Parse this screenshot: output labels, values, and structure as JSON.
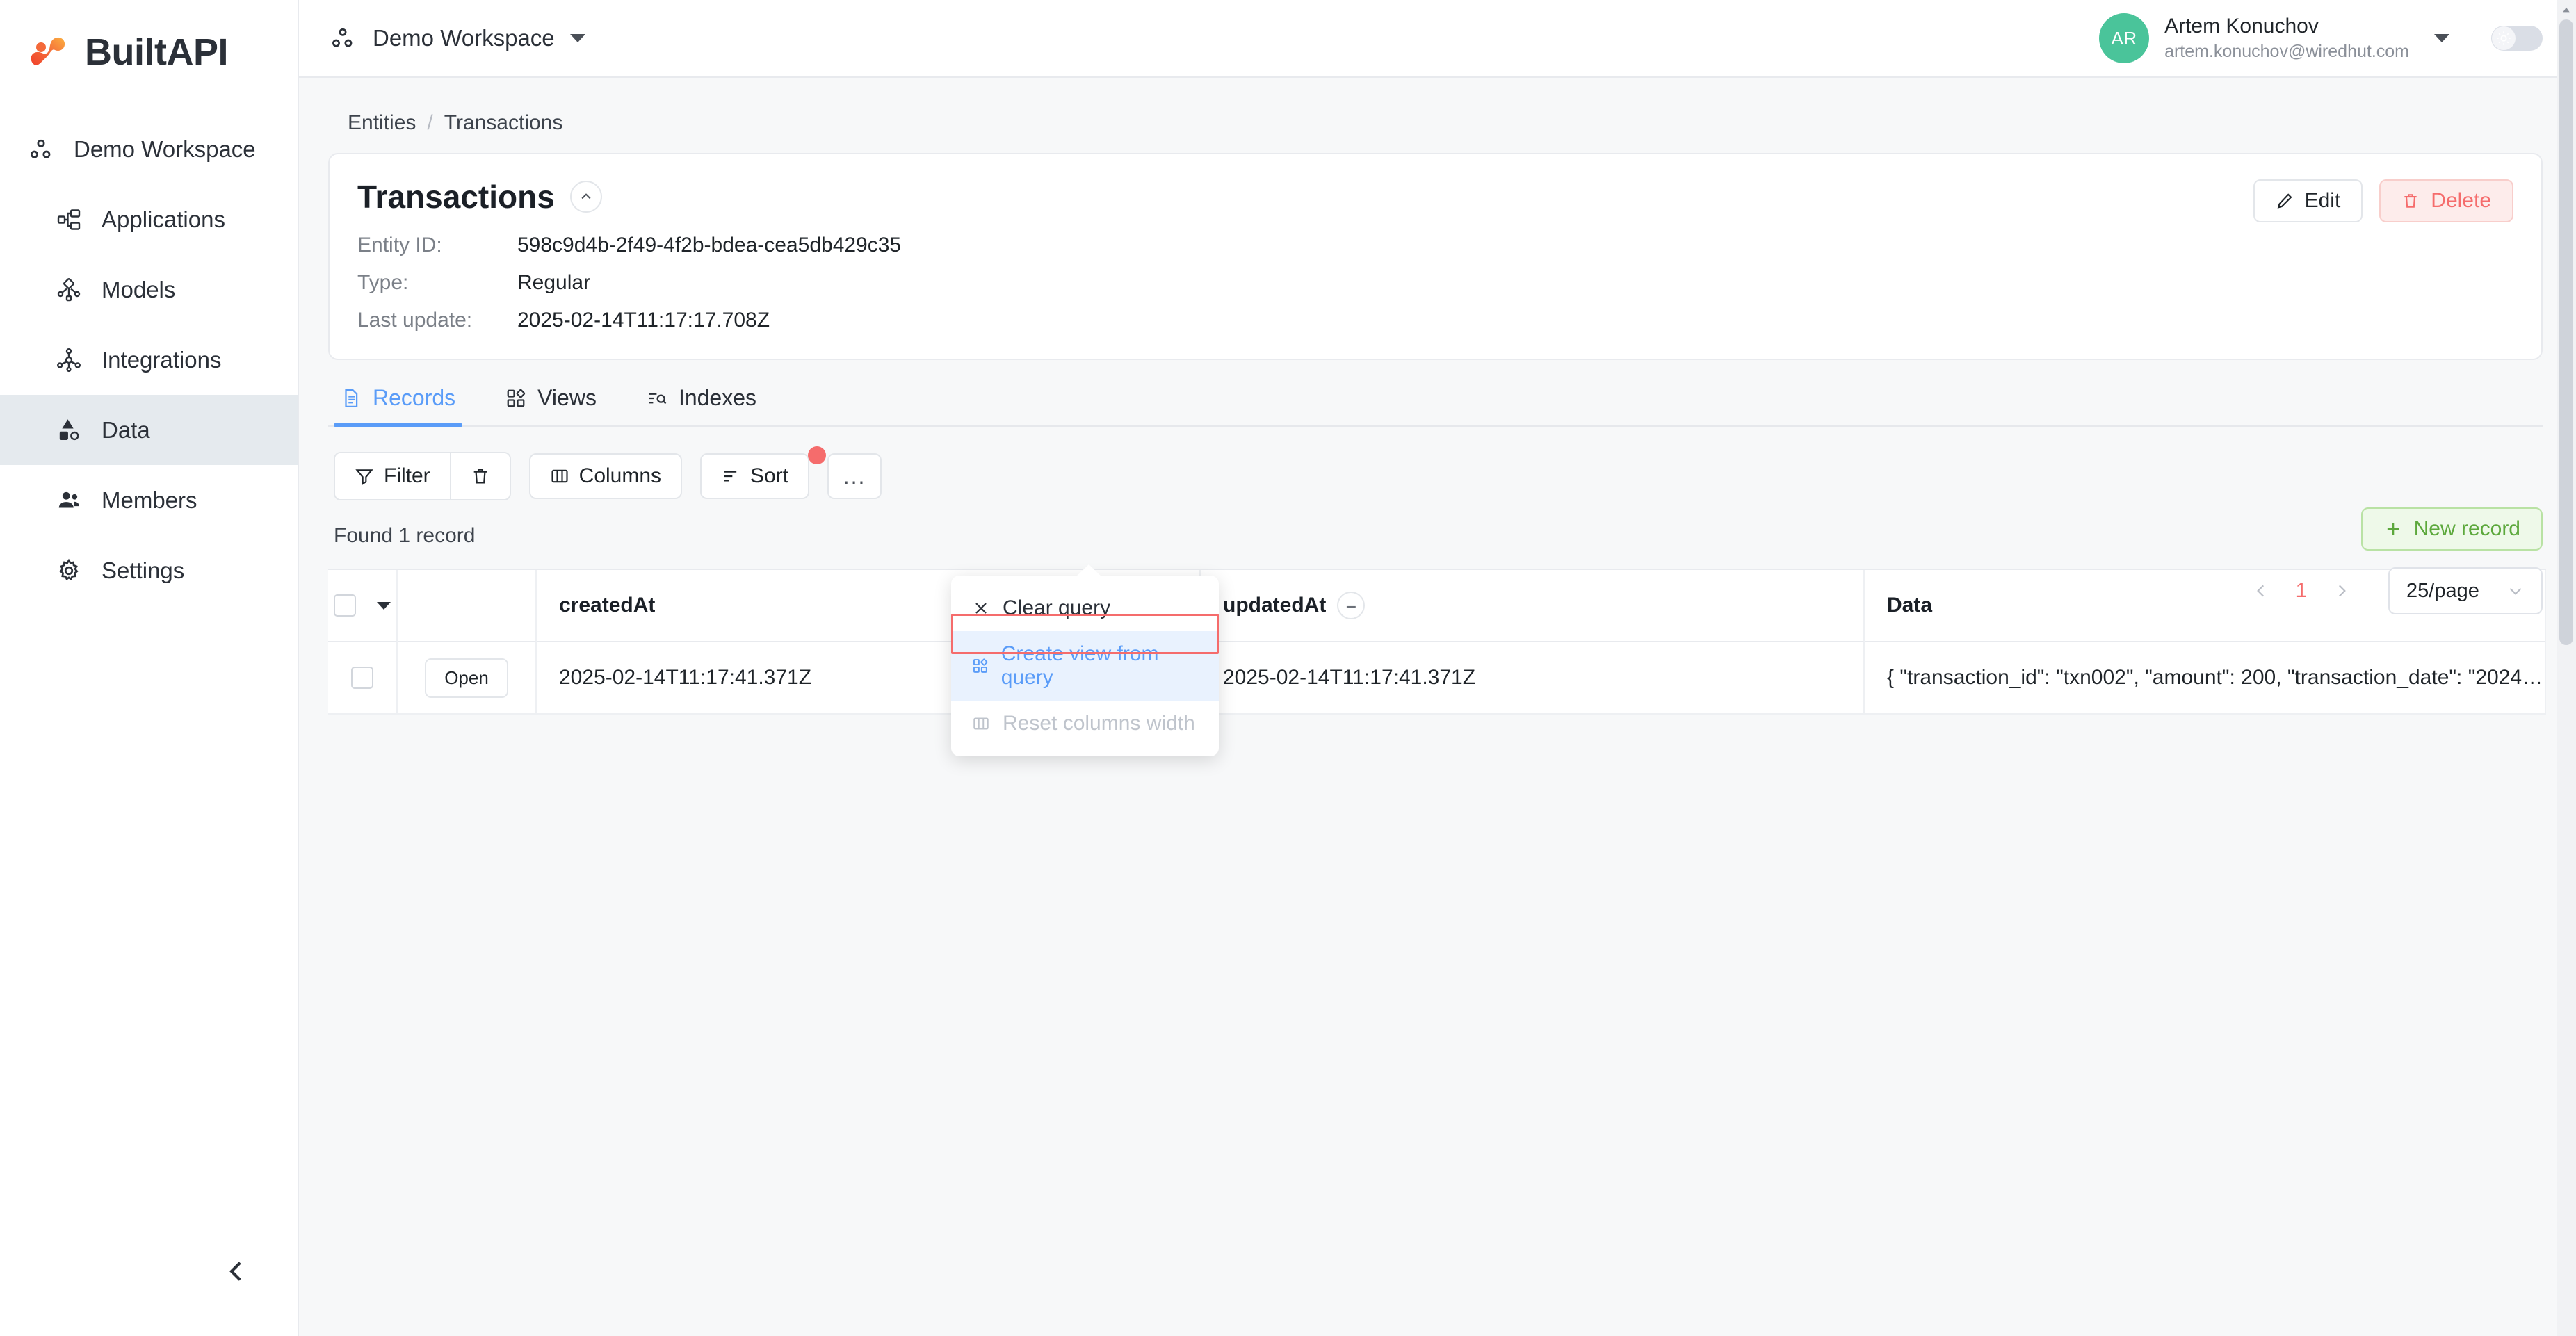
{
  "brand": {
    "name": "BuiltAPI",
    "logo_icon": "builtapi-logo-icon"
  },
  "sidebar": {
    "workspace_label": "Demo Workspace",
    "items": [
      {
        "label": "Applications",
        "icon": "applications-icon"
      },
      {
        "label": "Models",
        "icon": "models-icon"
      },
      {
        "label": "Integrations",
        "icon": "integrations-icon"
      },
      {
        "label": "Data",
        "icon": "data-icon"
      },
      {
        "label": "Members",
        "icon": "members-icon"
      },
      {
        "label": "Settings",
        "icon": "settings-gear-icon"
      }
    ],
    "active_item": "Data",
    "collapse_icon": "chevron-left-icon"
  },
  "topbar": {
    "workspace": "Demo Workspace",
    "workspace_icon": "workspace-dots-icon",
    "user": {
      "initials": "AR",
      "name": "Artem Konuchov",
      "email": "artem.konuchov@wiredhut.com"
    },
    "theme_toggle_icon": "sun-icon"
  },
  "breadcrumb": {
    "root": "Entities",
    "separator": "/",
    "current": "Transactions"
  },
  "entity": {
    "title": "Transactions",
    "collapse_icon": "chevron-up-icon",
    "fields": [
      {
        "key": "Entity ID:",
        "value": "598c9d4b-2f49-4f2b-bdea-cea5db429c35"
      },
      {
        "key": "Type:",
        "value": "Regular"
      },
      {
        "key": "Last update:",
        "value": "2025-02-14T11:17:17.708Z"
      }
    ],
    "edit_label": "Edit",
    "edit_icon": "pencil-icon",
    "delete_label": "Delete",
    "delete_icon": "trash-icon"
  },
  "tabs": [
    {
      "label": "Records",
      "icon": "document-icon",
      "active": true
    },
    {
      "label": "Views",
      "icon": "views-grid-icon",
      "active": false
    },
    {
      "label": "Indexes",
      "icon": "indexes-icon",
      "active": false
    }
  ],
  "toolbar": {
    "filter_label": "Filter",
    "filter_icon": "funnel-icon",
    "filter_clear_icon": "trash-icon",
    "columns_label": "Columns",
    "columns_icon": "columns-icon",
    "sort_label": "Sort",
    "sort_icon": "sort-icon",
    "more_label": "...",
    "new_record_label": "New record",
    "new_record_icon": "plus-icon",
    "has_filter_badge": true
  },
  "dropdown": {
    "items": [
      {
        "label": "Clear query",
        "icon": "close-x-icon",
        "state": "normal"
      },
      {
        "label": "Create view from query",
        "icon": "views-grid-icon",
        "state": "highlighted"
      },
      {
        "label": "Reset columns width",
        "icon": "columns-icon",
        "state": "disabled"
      }
    ]
  },
  "results": {
    "found_text": "Found 1 record"
  },
  "pagination": {
    "prev_icon": "chevron-left-icon",
    "next_icon": "chevron-right-icon",
    "current_page": "1",
    "page_size": "25/page",
    "page_size_caret_icon": "chevron-down-icon"
  },
  "table": {
    "columns": [
      {
        "key": "select",
        "label": ""
      },
      {
        "key": "open",
        "label": ""
      },
      {
        "key": "createdAt",
        "label": "createdAt"
      },
      {
        "key": "updatedAt",
        "label": "updatedAt",
        "sort_glyph": "–"
      },
      {
        "key": "data",
        "label": "Data"
      }
    ],
    "rows": [
      {
        "open_label": "Open",
        "createdAt": "2025-02-14T11:17:41.371Z",
        "updatedAt": "2025-02-14T11:17:41.371Z",
        "data": "{ \"transaction_id\": \"txn002\", \"amount\": 200, \"transaction_date\": \"2024-…"
      }
    ]
  },
  "colors": {
    "accent_blue": "#5a9cf8",
    "danger_red": "#f56c6c",
    "success_green": "#5ca83c",
    "avatar_green": "#4ac49a"
  }
}
